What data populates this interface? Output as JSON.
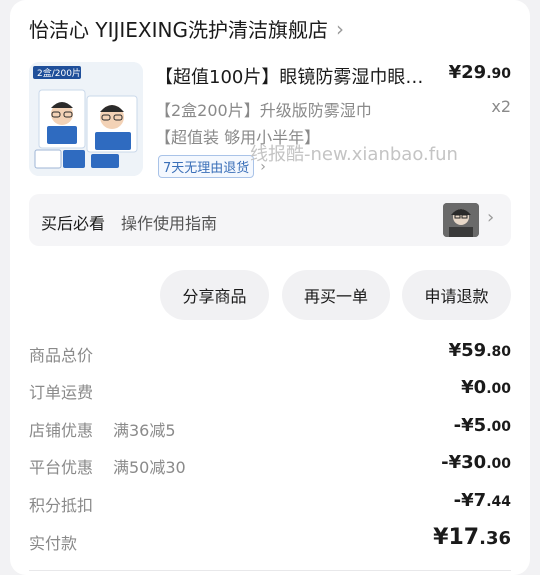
{
  "store": {
    "name": "怡洁心 YIJIEXING洗护清洁旗舰店",
    "chevron": "›"
  },
  "product": {
    "image_badge": "2盒/200片",
    "title": "【超值100片】眼镜防雾湿巾眼镜布",
    "price_main": "¥29",
    "price_decimal": ".90",
    "spec": "【2盒200片】升级版防雾湿巾",
    "quantity": "x2",
    "tag": "【超值装 够用小半年】",
    "service_badge": "7天无理由退货",
    "chevron": "›"
  },
  "watermark": "线报酷-new.xianbao.fun",
  "guide": {
    "label": "买后必看",
    "text": "操作使用指南",
    "chevron": "›"
  },
  "actions": [
    {
      "label": "分享商品"
    },
    {
      "label": "再买一单"
    },
    {
      "label": "申请退款"
    }
  ],
  "summary": [
    {
      "label": "商品总价",
      "note": "",
      "main": "¥59",
      "decimal": ".80"
    },
    {
      "label": "订单运费",
      "note": "",
      "main": "¥0",
      "decimal": ".00"
    },
    {
      "label": "店铺优惠",
      "note": "满36减5",
      "main": "-¥5",
      "decimal": ".00"
    },
    {
      "label": "平台优惠",
      "note": "满50减30",
      "main": "-¥30",
      "decimal": ".00"
    },
    {
      "label": "积分抵扣",
      "note": "",
      "main": "-¥7",
      "decimal": ".44"
    }
  ],
  "total": {
    "label": "实付款",
    "main": "¥17",
    "decimal": ".36"
  },
  "icons": {
    "store_chevron": "chevron-right-icon",
    "service_chevron": "chevron-right-icon",
    "guide_chevron": "chevron-right-icon"
  },
  "colors": {
    "service_badge_text": "#3a6fb8",
    "button_bg": "#f1f1f3",
    "card_bg": "#ffffff"
  }
}
